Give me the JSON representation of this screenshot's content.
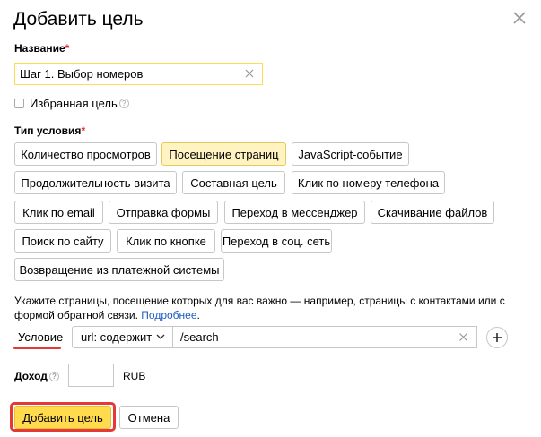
{
  "dialog": {
    "title": "Добавить цель",
    "close_icon": "close-icon"
  },
  "name": {
    "label": "Название",
    "required_mark": "*",
    "value": "Шаг 1. Выбор номеров"
  },
  "favorite": {
    "label": "Избранная цель",
    "checked": false,
    "help_glyph": "?"
  },
  "condition_type": {
    "label": "Тип условия",
    "required_mark": "*",
    "selected": "Посещение страниц",
    "options": [
      "Количество просмотров",
      "Посещение страниц",
      "JavaScript-событие",
      "Продолжительность визита",
      "Составная цель",
      "Клик по номеру телефона",
      "Клик по email",
      "Отправка формы",
      "Переход в мессенджер",
      "Скачивание файлов",
      "Поиск по сайту",
      "Клик по кнопке",
      "Переход в соц. сеть",
      "Возвращение из платежной системы"
    ]
  },
  "description": {
    "text": "Укажите страницы, посещение которых для вас важно — например, страницы с контактами или с формой обратной связи.",
    "link": "Подробнее",
    "end": "."
  },
  "condition": {
    "label": "Условие",
    "select_value": "url: содержит",
    "input_value": "/search",
    "add_icon": "plus-icon"
  },
  "income": {
    "label": "Доход",
    "help_glyph": "?",
    "value": "",
    "currency": "RUB"
  },
  "actions": {
    "submit_label": "Добавить цель",
    "cancel_label": "Отмена"
  },
  "colors": {
    "accent_yellow": "#ffdb4d",
    "selected_bg": "#fff3c2",
    "highlight_red": "#e53935",
    "link_blue": "#1d5ec0",
    "required_red": "#e02e2e"
  }
}
